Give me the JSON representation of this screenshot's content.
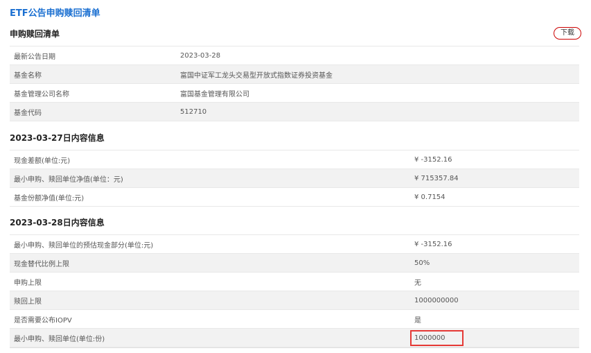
{
  "page_title": "ETF公告申购赎回清单",
  "list_section": {
    "title": "申购赎回清单",
    "download_label": "下载",
    "rows": [
      {
        "label": "最新公告日期",
        "value": "2023-03-28"
      },
      {
        "label": "基金名称",
        "value": "富国中证军工龙头交易型开放式指数证券投资基金"
      },
      {
        "label": "基金管理公司名称",
        "value": "富国基金管理有限公司"
      },
      {
        "label": "基金代码",
        "value": "512710"
      }
    ]
  },
  "section_0327": {
    "title": "2023-03-27日内容信息",
    "rows": [
      {
        "label": "现金差额(单位:元)",
        "value": "¥ -3152.16"
      },
      {
        "label": "最小申购、赎回单位净值(单位：元)",
        "value": "¥ 715357.84"
      },
      {
        "label": "基金份额净值(单位:元)",
        "value": "¥ 0.7154"
      }
    ]
  },
  "section_0328": {
    "title": "2023-03-28日内容信息",
    "rows": [
      {
        "label": "最小申购、赎回单位的预估现金部分(单位:元)",
        "value": "¥ -3152.16"
      },
      {
        "label": "现金替代比例上限",
        "value": "50%"
      },
      {
        "label": "申购上限",
        "value": "无"
      },
      {
        "label": "赎回上限",
        "value": "1000000000"
      },
      {
        "label": "是否需要公布IOPV",
        "value": "是"
      },
      {
        "label": "最小申购、赎回单位(单位:份)",
        "value": "1000000"
      }
    ]
  }
}
